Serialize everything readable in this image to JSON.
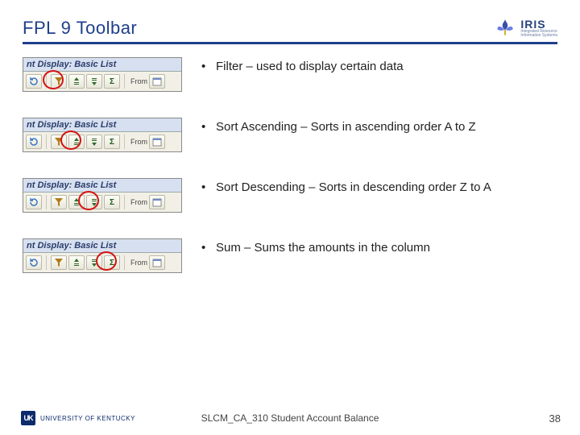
{
  "header": {
    "title": "FPL 9 Toolbar",
    "logo": {
      "brand": "IRIS",
      "tagline1": "Integrated Resource",
      "tagline2": "Information Systems"
    }
  },
  "snip": {
    "window_title_fragment": "nt Display: Basic List",
    "from_label": "From"
  },
  "bullets": {
    "b1": "Filter – used to display certain data",
    "b2": "Sort Ascending – Sorts in ascending order A to Z",
    "b3": "Sort Descending – Sorts in descending order Z to A",
    "b4": "Sum – Sums the amounts in the column"
  },
  "footer": {
    "org_abbrev": "UK",
    "org_name": "UNIVERSITY OF KENTUCKY",
    "doc_id": "SLCM_CA_310 Student Account Balance",
    "page_number": "38"
  }
}
